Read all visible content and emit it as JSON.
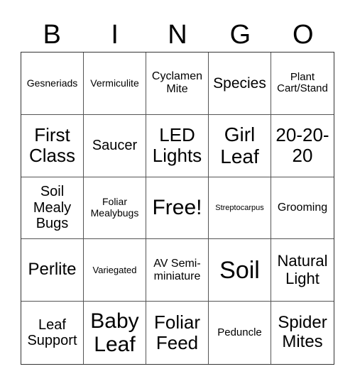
{
  "header": {
    "letters": [
      "B",
      "I",
      "N",
      "G",
      "O"
    ]
  },
  "grid": {
    "cells": [
      "Gesneriads",
      "Vermiculite",
      "Cyclamen Mite",
      "Species",
      "Plant Cart/Stand",
      "First Class",
      "Saucer",
      "LED Lights",
      "Girl Leaf",
      "20-20-20",
      "Soil Mealy Bugs",
      "Foliar Mealybugs",
      "Free!",
      "Streptocarpus",
      "Grooming",
      "Perlite",
      "Variegated",
      "AV Semi-miniature",
      "Soil",
      "Natural Light",
      "Leaf Support",
      "Baby Leaf",
      "Foliar Feed",
      "Peduncle",
      "Spider Mites"
    ]
  }
}
